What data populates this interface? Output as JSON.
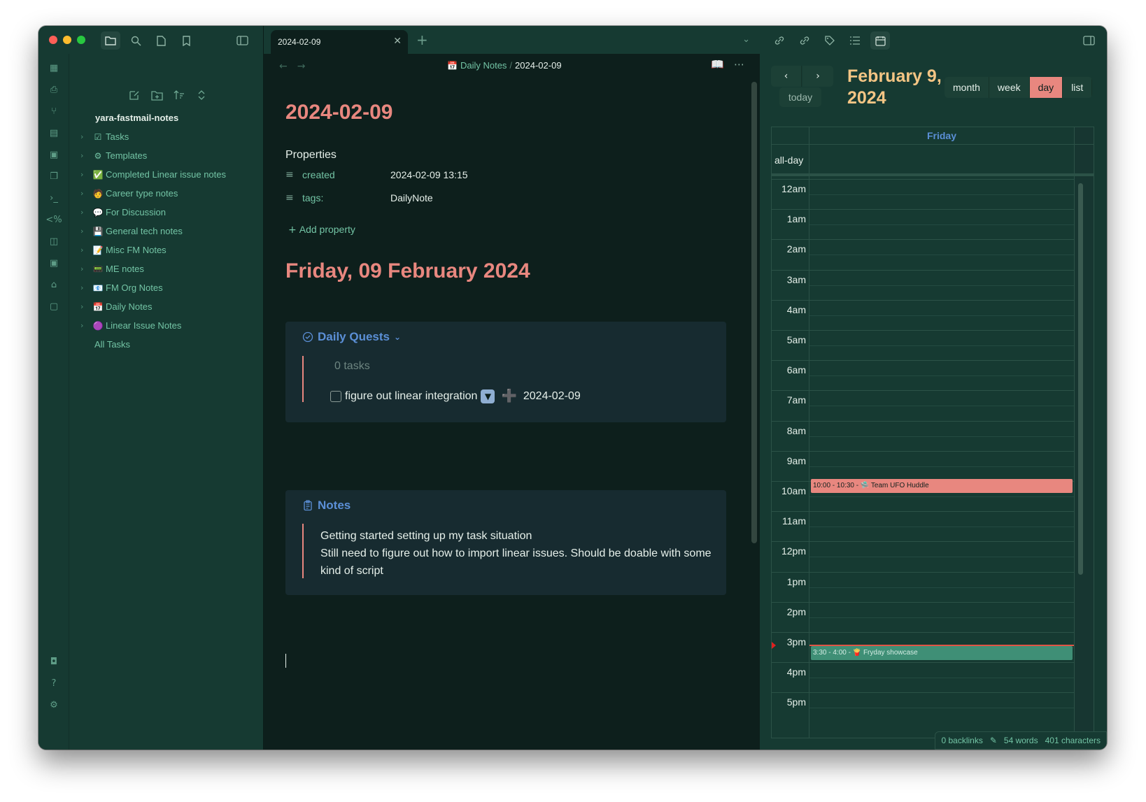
{
  "colors": {
    "accent_heading": "#e8877f",
    "calendar_title": "#f4c584",
    "link": "#73c4a5",
    "callout_title": "#5b8fd6",
    "sidebar_bg": "#163a32",
    "editor_bg": "#0d1f1c",
    "event_pink": "#e8877f",
    "event_green": "#3f8f76"
  },
  "sidebar": {
    "vault_name": "yara-fastmail-notes",
    "items": [
      {
        "emoji": "☑",
        "label": "Tasks"
      },
      {
        "emoji": "⚙",
        "label": "Templates"
      },
      {
        "emoji": "✅",
        "label": "Completed Linear issue notes"
      },
      {
        "emoji": "🧑",
        "label": "Career type notes"
      },
      {
        "emoji": "💬",
        "label": "For Discussion"
      },
      {
        "emoji": "💾",
        "label": "General tech notes"
      },
      {
        "emoji": "📝",
        "label": "Misc FM Notes"
      },
      {
        "emoji": "📟",
        "label": "ME notes"
      },
      {
        "emoji": "📧",
        "label": "FM Org Notes"
      },
      {
        "emoji": "📅",
        "label": "Daily Notes"
      },
      {
        "emoji": "🟣",
        "label": "Linear Issue Notes"
      }
    ],
    "all_tasks": "All Tasks"
  },
  "editor": {
    "tab_title": "2024-02-09",
    "breadcrumb_folder": "Daily Notes",
    "breadcrumb_sep": "/",
    "breadcrumb_current": "2024-02-09",
    "note_title": "2024-02-09",
    "properties_heading": "Properties",
    "properties": [
      {
        "key": "created",
        "value": "2024-02-09 13:15"
      },
      {
        "key": "tags:",
        "value": "DailyNote"
      }
    ],
    "add_property": "Add property",
    "heading": "Friday, 09 February 2024",
    "quests": {
      "title": "Daily Quests",
      "count": "0 tasks",
      "task_text": "figure out linear integration",
      "task_date": "2024-02-09"
    },
    "notes": {
      "title": "Notes",
      "line1": "Getting started setting up my task situation",
      "line2": "Still need to figure out how to import linear issues. Should be doable with some kind of script"
    }
  },
  "calendar": {
    "title_line1": "February 9,",
    "title_line2": "2024",
    "today": "today",
    "views": [
      "month",
      "week",
      "day",
      "list"
    ],
    "active_view": "day",
    "day_header": "Friday",
    "all_day": "all-day",
    "hours": [
      "12am",
      "1am",
      "2am",
      "3am",
      "4am",
      "5am",
      "6am",
      "7am",
      "8am",
      "9am",
      "10am",
      "11am",
      "12pm",
      "1pm",
      "2pm",
      "3pm",
      "4pm",
      "5pm"
    ],
    "events": [
      {
        "time": "10:00 - 10:30",
        "emoji": "🛸",
        "title": "Team UFO Huddle"
      },
      {
        "time": "3:30 - 4:00",
        "emoji": "🍟",
        "title": "Fryday showcase"
      }
    ]
  },
  "status": {
    "backlinks": "0 backlinks",
    "words": "54 words",
    "characters": "401 characters"
  }
}
